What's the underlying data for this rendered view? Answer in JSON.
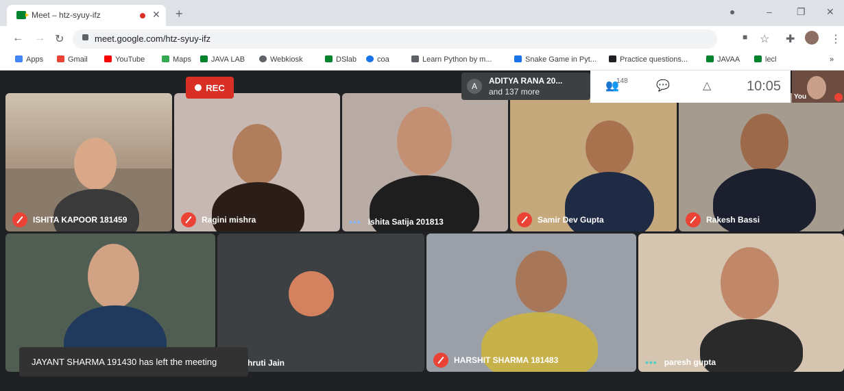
{
  "browser": {
    "tab_title": "Meet – htz-syuy-ifz",
    "url": "meet.google.com/htz-syuy-ifz",
    "bookmarks": [
      "Apps",
      "Gmail",
      "YouTube",
      "Maps",
      "JAVA LAB",
      "Webkiosk",
      "DSlab",
      "coa",
      "Learn Python by m...",
      "Snake Game in Pyt...",
      "Practice questions...",
      "JAVAA",
      "lecl"
    ]
  },
  "meet": {
    "rec_label": "REC",
    "presenter": {
      "avatar": "A",
      "name": "ADITYA RANA 20...",
      "more": "and 137 more"
    },
    "participant_count": "148",
    "time": "10:05",
    "you_label": "You",
    "toast": "JAYANT SHARMA 191430 has left the meeting",
    "tiles": [
      {
        "name": "ISHITA KAPOOR 181459",
        "muted": true
      },
      {
        "name": "Ragini mishra",
        "muted": true
      },
      {
        "name": "Ishita Satija 201813",
        "muted": false
      },
      {
        "name": "Samir Dev Gupta",
        "muted": true
      },
      {
        "name": "Rakesh Bassi",
        "muted": true
      },
      {
        "name": "",
        "muted": true
      },
      {
        "name": "hruti Jain",
        "muted": false
      },
      {
        "name": "HARSHIT SHARMA 181483",
        "muted": true
      },
      {
        "name": "paresh gupta",
        "muted": false
      }
    ]
  }
}
